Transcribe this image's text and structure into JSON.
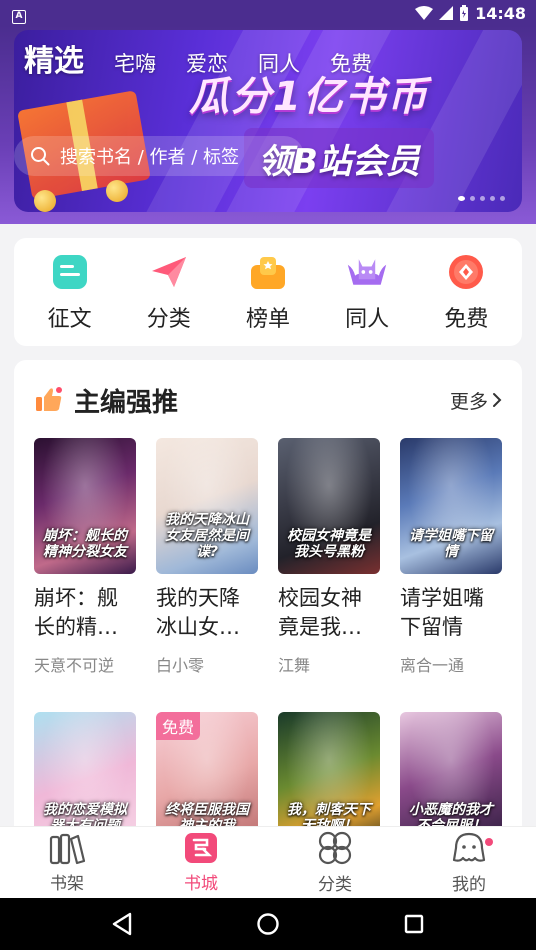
{
  "status_bar": {
    "time": "14:48"
  },
  "top_tabs": [
    {
      "label": "精选",
      "active": true
    },
    {
      "label": "宅嗨",
      "active": false
    },
    {
      "label": "爱恋",
      "active": false
    },
    {
      "label": "同人",
      "active": false
    },
    {
      "label": "免费",
      "active": false
    }
  ],
  "search": {
    "placeholder": "搜索书名 / 作者 / 标签"
  },
  "banner": {
    "headline": "瓜分1亿书币",
    "sub": "领B站会员"
  },
  "quick_menu": [
    {
      "label": "征文",
      "icon": "contest-icon"
    },
    {
      "label": "分类",
      "icon": "paper-plane-icon"
    },
    {
      "label": "榜单",
      "icon": "ranking-icon"
    },
    {
      "label": "同人",
      "icon": "bat-icon"
    },
    {
      "label": "免费",
      "icon": "free-coin-icon"
    }
  ],
  "recommend": {
    "title": "主编强推",
    "more_label": "更多",
    "books_row1": [
      {
        "name": "崩坏：舰长的精神分裂女友",
        "author": "天意不可逆",
        "cover_text": "崩坏：舰长的精神分裂女友"
      },
      {
        "name": "我的天降冰山女友居然是间谍",
        "author": "白小零",
        "cover_text": "我的天降冰山女友居然是间谍?"
      },
      {
        "name": "校园女神竟是我头号黑粉",
        "author": "江舞",
        "cover_text": "校园女神竟是我头号黑粉"
      },
      {
        "name": "请学姐嘴下留情",
        "author": "离合一通",
        "cover_text": "请学姐嘴下留情"
      }
    ],
    "books_row2": [
      {
        "cover_text": "我的恋爱模拟器大有问题",
        "free_tag": ""
      },
      {
        "cover_text": "终将臣服我国神主的我",
        "free_tag": "免费"
      },
      {
        "cover_text": "我，刺客天下无敌啊！",
        "free_tag": ""
      },
      {
        "cover_text": "小恶魔的我才不会屈服！",
        "free_tag": ""
      }
    ]
  },
  "display_names": [
    "崩坏：舰长的精…",
    "我的天降冰山女…",
    "校园女神竟是我…",
    "请学姐嘴下留情"
  ],
  "bottom_nav": [
    {
      "label": "书架",
      "active": false
    },
    {
      "label": "书城",
      "active": true
    },
    {
      "label": "分类",
      "active": false
    },
    {
      "label": "我的",
      "active": false
    }
  ]
}
